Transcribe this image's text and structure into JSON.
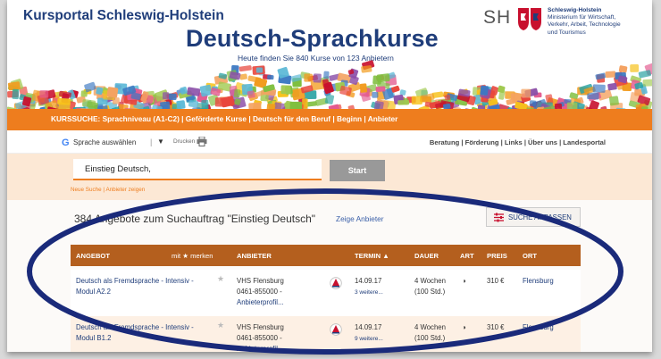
{
  "header": {
    "portal_title": "Kursportal Schleswig-Holstein",
    "main_title": "Deutsch-Sprachkurse",
    "subtitle": "Heute finden Sie 840 Kurse von 123 Anbietern",
    "sh_logo": "SH",
    "ministry_line1": "Schleswig-Holstein",
    "ministry_line2": "Ministerium für Wirtschaft,",
    "ministry_line3": "Verkehr, Arbeit, Technologie",
    "ministry_line4": "und Tourismus"
  },
  "nav": {
    "text": "KURSSUCHE: Sprachniveau (A1-C2)  |  Geförderte Kurse  |  Deutsch für den Beruf  |  Beginn  |  Anbieter"
  },
  "service": {
    "language_select": "Sprache auswählen",
    "language_arrow": "▼",
    "print_label": "Drucken",
    "links": "Beratung  |  Förderung  |  Links  |  Über uns  |  Landesportal"
  },
  "search": {
    "value": "Einstieg Deutsch,",
    "start_label": "Start",
    "sub_links": "Neue Suche  |  Anbieter zeigen"
  },
  "results": {
    "title": "384 Angebote zum Suchauftrag \"Einstieg Deutsch\"",
    "show_providers": "Zeige Anbieter",
    "adjust_label": "SUCHE ANPASSEN",
    "columns": {
      "angebot": "ANGEBOT",
      "merken": "mit ★ merken",
      "anbieter": "ANBIETER",
      "termin": "TERMIN ▲",
      "dauer": "DAUER",
      "art": "ART",
      "preis": "PREIS",
      "ort": "ORT"
    },
    "rows": [
      {
        "title_line1": "Deutsch als Fremdsprache - Intensiv -",
        "title_line2": "Modul A2.2",
        "star": "★",
        "provider_line1": "VHS Flensburg",
        "provider_line2": "0461-855000 -",
        "provider_line3": "Anbieterprofil...",
        "date": "14.09.17",
        "more": "3 weitere...",
        "duration_line1": "4 Wochen",
        "duration_line2": "(100 Std.)",
        "art": "◑",
        "price": "310 €",
        "city": "Flensburg"
      },
      {
        "title_line1": "Deutsch als Fremdsprache - Intensiv -",
        "title_line2": "Modul B1.2",
        "star": "★",
        "provider_line1": "VHS Flensburg",
        "provider_line2": "0461-855000 -",
        "provider_line3": "Anbieterprofil...",
        "date": "14.09.17",
        "more": "9 weitere...",
        "duration_line1": "4 Wochen",
        "duration_line2": "(100 Std.)",
        "art": "◑",
        "price": "310 €",
        "city": "Flensburg"
      }
    ]
  },
  "colors": {
    "brand_blue": "#1f3d7a",
    "nav_orange": "#ee7d1e",
    "table_header": "#b45f1e",
    "ellipse": "#1a2a7a"
  }
}
